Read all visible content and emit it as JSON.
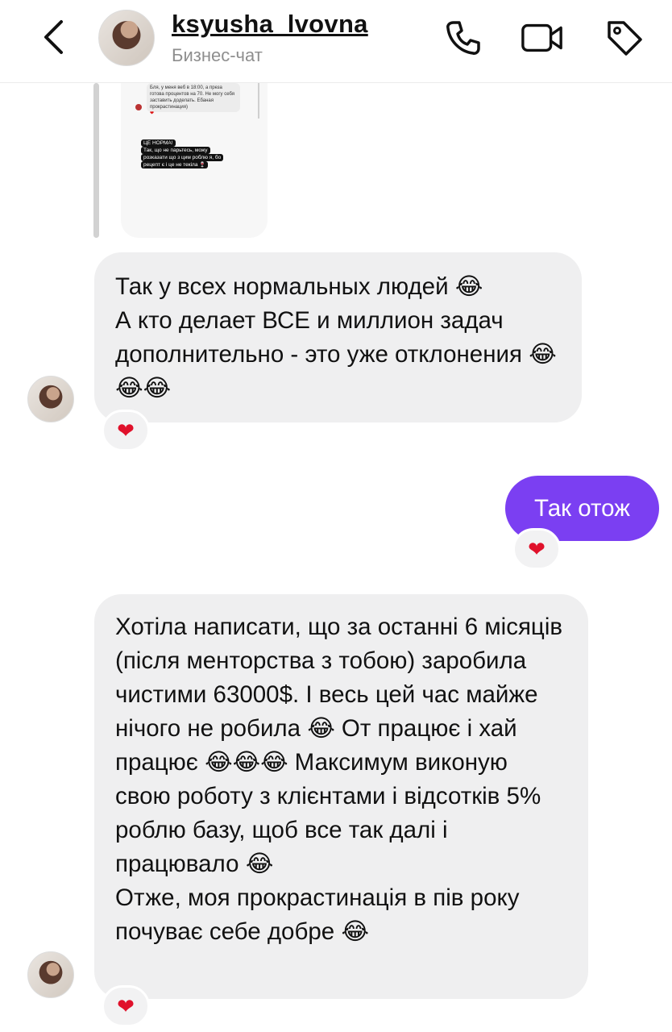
{
  "header": {
    "username": "ksyusha_lvovna",
    "subtitle": "Бизнес-чат",
    "icons": [
      "back-icon",
      "phone-icon",
      "video-icon",
      "tag-icon"
    ]
  },
  "quoted": {
    "bubble_text": "Бля, у меня веб в 18:00, а преза готова процентов на 70. Не могу себя заставить доделать. Ебаная прокрастинация)",
    "dark_lines": [
      "ЦЕ НОРМА!",
      "Так, що не парьтесь, можу",
      "розказати що з цим роблю я, бо",
      "рецепт є і це не текіла 🍷"
    ]
  },
  "messages": [
    {
      "direction": "incoming",
      "text": "Так у всех нормальных людей 😂\nА кто делает ВСЕ и миллион задач дополнительно - это уже отклонения 😂😂😂",
      "reaction": "❤"
    },
    {
      "direction": "outgoing",
      "text": "Так отож",
      "reaction": "❤"
    },
    {
      "direction": "incoming",
      "text": "Хотіла написати, що за останні 6 місяців (після менторства з тобою) заробила чистими 63000$. І весь цей час майже нічого не робила 😂 От працює і хай працює 😂😂😂 Максимум виконую свою роботу з клієнтами і відсотків 5% роблю базу, щоб все так далі і працювало 😂\nОтже, моя прокрастинація в пів року почуває себе добре 😂",
      "reaction": "❤"
    }
  ],
  "colors": {
    "outgoing_bubble": "#7b3ff2",
    "incoming_bubble": "#efeff0",
    "reaction_heart": "#e0112b",
    "subtitle": "#8e8e8e"
  }
}
